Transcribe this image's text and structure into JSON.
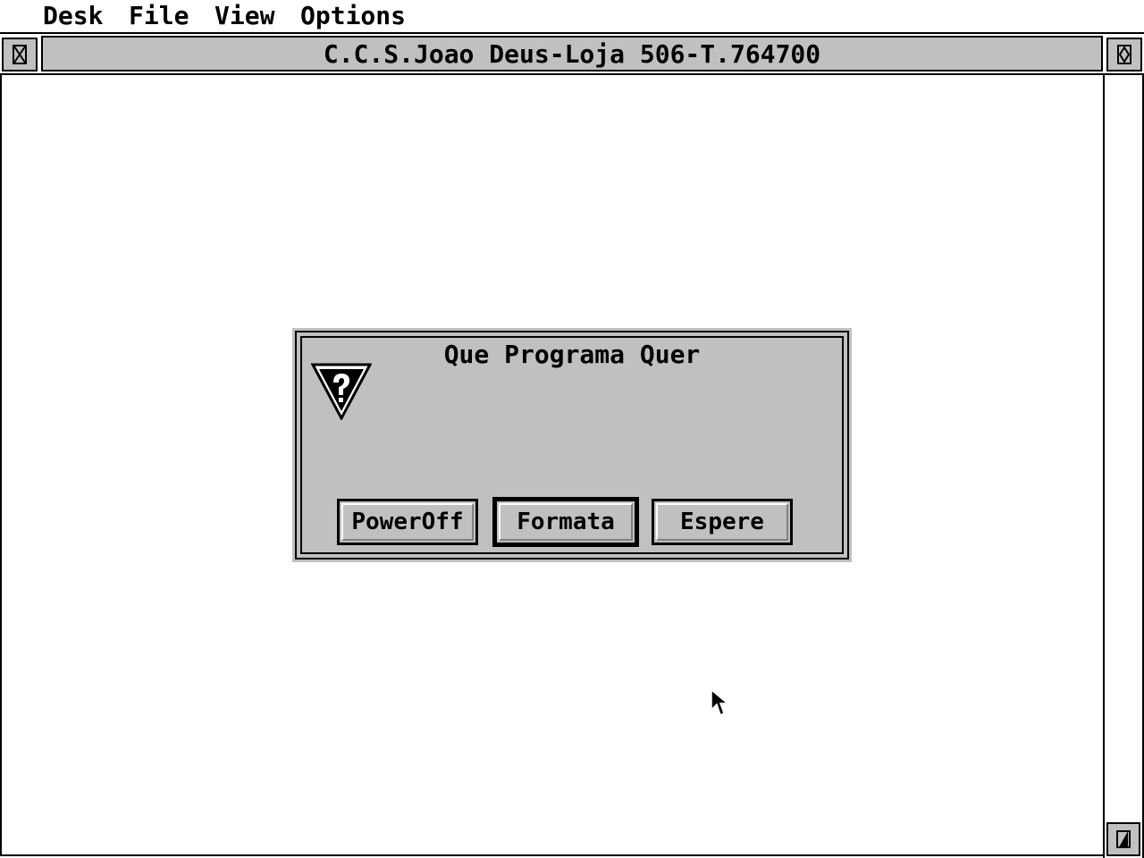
{
  "menubar": {
    "items": [
      "Desk",
      "File",
      "View",
      "Options"
    ]
  },
  "window": {
    "title": "C.C.S.Joao Deus-Loja 506-T.764700"
  },
  "dialog": {
    "title": "Que Programa Quer",
    "icon": "question-icon",
    "buttons": [
      {
        "label": "PowerOff",
        "default": false
      },
      {
        "label": "Formata",
        "default": true
      },
      {
        "label": "Espere",
        "default": false
      }
    ]
  },
  "colors": {
    "desktop": "#ffffff",
    "dialog_bg": "#c0c0c0",
    "border": "#000000"
  }
}
